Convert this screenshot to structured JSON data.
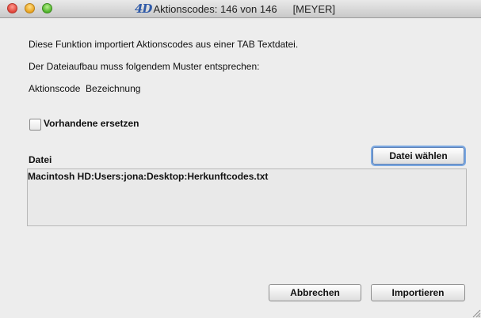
{
  "window": {
    "title": "Aktionscodes: 146 von 146",
    "title_suffix": "[MEYER]",
    "app_logo_text": "4D"
  },
  "content": {
    "description": "Diese Funktion importiert Aktionscodes aus einer TAB Textdatei.",
    "format_intro": "Der Dateiaufbau muss folgendem Muster entsprechen:",
    "format_pattern": "Aktionscode  Bezeichnung"
  },
  "replace_checkbox": {
    "label": "Vorhandene ersetzen",
    "checked": false
  },
  "file": {
    "section_label": "Datei",
    "choose_button": "Datei wählen",
    "path": "Macintosh HD:Users:jona:Desktop:Herkunftcodes.txt"
  },
  "footer": {
    "cancel_button": "Abbrechen",
    "import_button": "Importieren"
  },
  "colors": {
    "window_bg": "#ededed",
    "focus_ring": "#7aa7e0",
    "logo": "#2f5aa8"
  }
}
